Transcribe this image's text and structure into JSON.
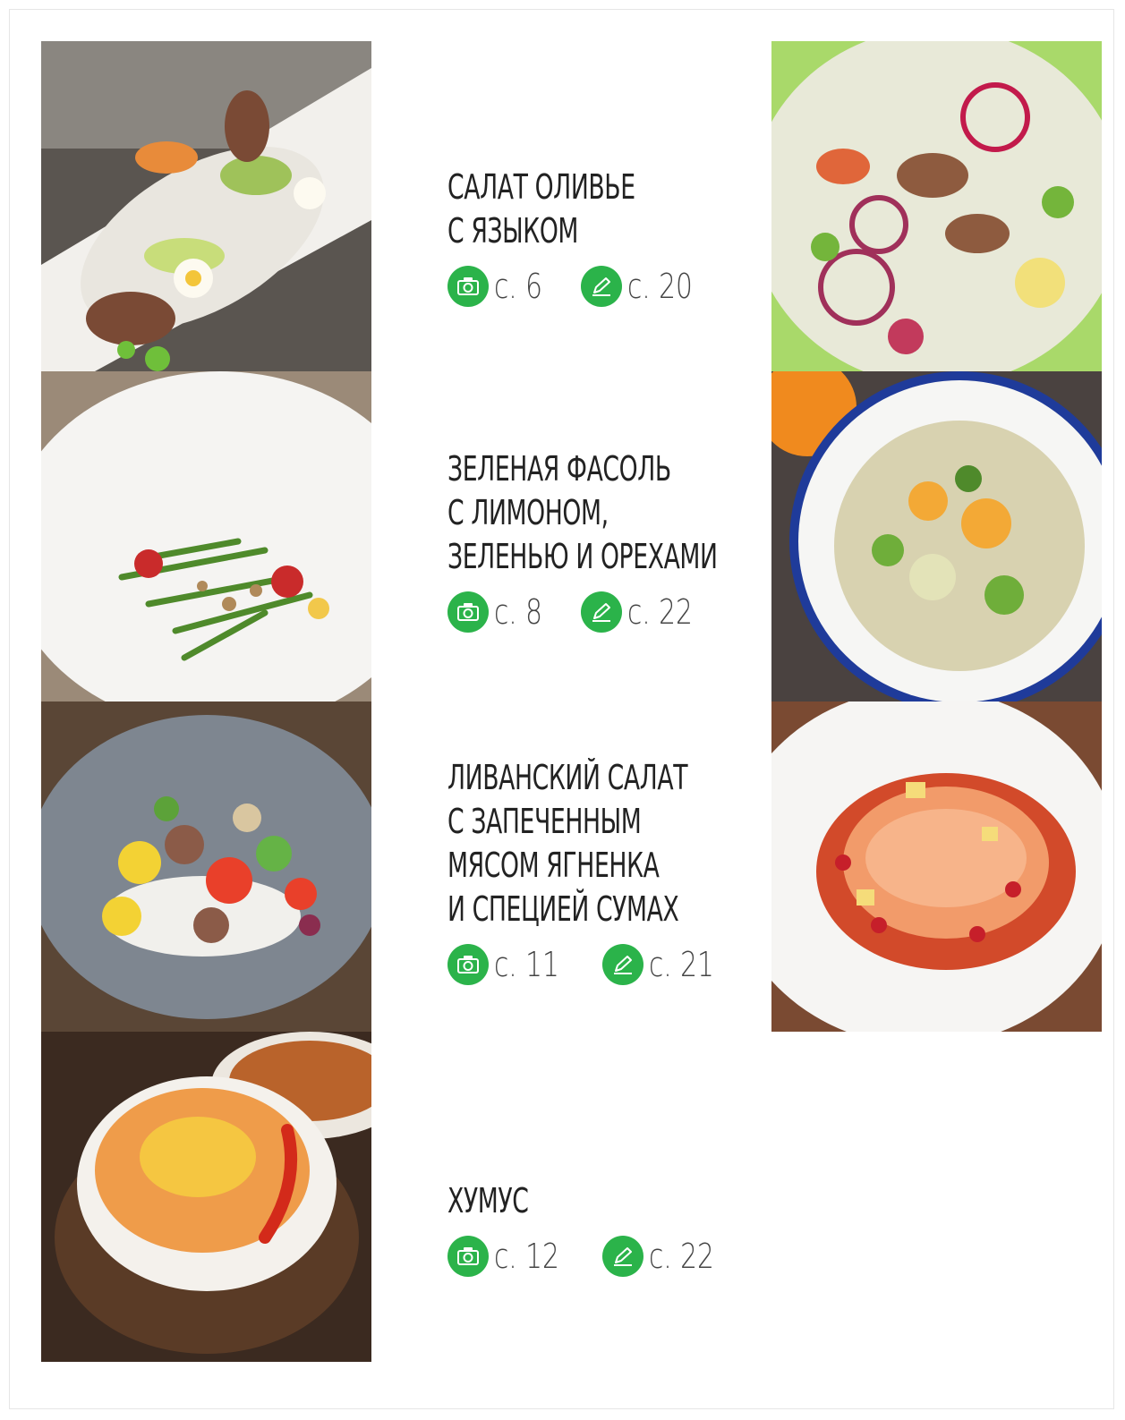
{
  "recipes": [
    {
      "title_lines": [
        "САЛАТ ОЛИВЬЕ",
        "С ЯЗЫКОМ"
      ],
      "photo_ref": "с. 6",
      "recipe_ref": "с. 20"
    },
    {
      "title_lines": [
        "ЗЕЛЕНАЯ ФАСОЛЬ",
        "С ЛИМОНОМ,",
        "ЗЕЛЕНЬЮ И ОРЕХАМИ"
      ],
      "photo_ref": "с. 8",
      "recipe_ref": "с. 22"
    },
    {
      "title_lines": [
        "ЛИВАНСКИЙ САЛАТ",
        "С ЗАПЕЧЕННЫМ",
        "МЯСОМ ЯГНЕНКА",
        "И СПЕЦИЕЙ СУМАХ"
      ],
      "photo_ref": "с. 11",
      "recipe_ref": "с. 21"
    },
    {
      "title_lines": [
        "ХУМУС"
      ],
      "photo_ref": "с. 12",
      "recipe_ref": "с. 22"
    }
  ],
  "colors": {
    "accent_green": "#2bb34a"
  },
  "icons": {
    "photo_ref": "camera-icon",
    "recipe_ref": "pencil-icon"
  }
}
